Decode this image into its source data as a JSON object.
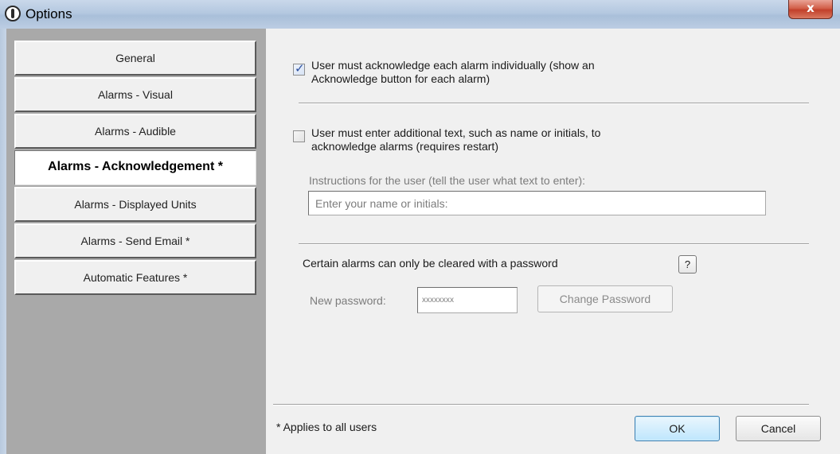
{
  "window": {
    "title": "Options",
    "close_glyph": "x"
  },
  "sidebar": {
    "items": [
      {
        "label": "General",
        "active": false
      },
      {
        "label": "Alarms - Visual",
        "active": false
      },
      {
        "label": "Alarms - Audible",
        "active": false
      },
      {
        "label": "Alarms - Acknowledgement *",
        "active": true
      },
      {
        "label": "Alarms - Displayed Units",
        "active": false
      },
      {
        "label": "Alarms - Send Email *",
        "active": false
      },
      {
        "label": "Automatic Features *",
        "active": false
      }
    ]
  },
  "ack": {
    "individual_checked": true,
    "individual_line1": "User must acknowledge each alarm individually (show an",
    "individual_line2": "Acknowledge button for each alarm)",
    "text_checked": false,
    "text_line1": "User must enter additional text, such as name or initials, to",
    "text_line2": "acknowledge alarms  (requires restart)",
    "instructions_label": "Instructions for the user (tell the user what text to enter):",
    "instructions_value": "Enter your name or initials:"
  },
  "password": {
    "heading": "Certain alarms can only be cleared with a password",
    "help_label": "?",
    "new_label": "New password:",
    "masked_value": "xxxxxxxx",
    "change_button": "Change Password"
  },
  "footer": {
    "note": "* Applies to all users",
    "ok": "OK",
    "cancel": "Cancel"
  },
  "icons": {
    "app": "app-logo-icon",
    "close": "close-icon",
    "check": "checkmark-icon"
  },
  "colors": {
    "sidebar_bg": "#a9a9a9",
    "content_bg": "#f0f0f0",
    "check_color": "#2c4f9e",
    "default_button_border": "#3c7fb1"
  }
}
